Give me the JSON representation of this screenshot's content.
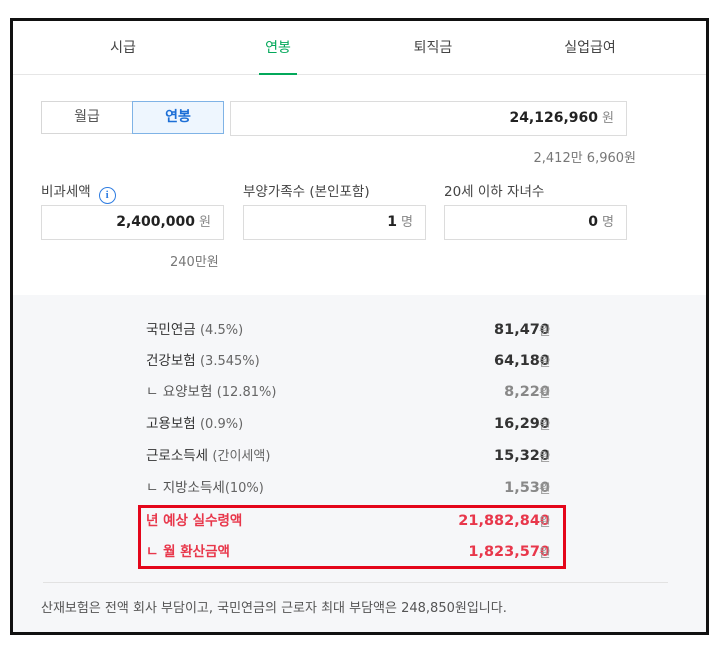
{
  "tabs": [
    "시급",
    "연봉",
    "퇴직금",
    "실업급여"
  ],
  "active_tab": "연봉",
  "pay_type": {
    "monthly": "월급",
    "annual": "연봉",
    "selected": "연봉"
  },
  "salary": {
    "value": "24,126,960",
    "unit": "원",
    "readable": "2,412만 6,960원"
  },
  "nontax": {
    "label": "비과세액",
    "info_icon": "info-icon",
    "value": "2,400,000",
    "unit": "원",
    "readable": "240만원"
  },
  "dependents": {
    "label": "부양가족수 (본인포함)",
    "value": "1",
    "unit": "명"
  },
  "children": {
    "label": "20세 이하 자녀수",
    "value": "0",
    "unit": "명"
  },
  "results": [
    {
      "name": "국민연금",
      "rate": "(4.5%)",
      "value": "81,470",
      "unit": "원",
      "sub": false
    },
    {
      "name": "건강보험",
      "rate": "(3.545%)",
      "value": "64,180",
      "unit": "원",
      "sub": false
    },
    {
      "name": "ㄴ 요양보험",
      "rate": "(12.81%)",
      "value": "8,220",
      "unit": "원",
      "sub": true
    },
    {
      "name": "고용보험",
      "rate": "(0.9%)",
      "value": "16,290",
      "unit": "원",
      "sub": false
    },
    {
      "name": "근로소득세",
      "rate": "(간이세액)",
      "value": "15,320",
      "unit": "원",
      "sub": false
    },
    {
      "name": "ㄴ 지방소득세",
      "rate": "(10%)",
      "value": "1,530",
      "unit": "원",
      "sub": true
    }
  ],
  "highlight": [
    {
      "name": "년 예상 실수령액",
      "value": "21,882,840",
      "unit": "원"
    },
    {
      "name": "ㄴ 월 환산금액",
      "value": "1,823,570",
      "unit": "원"
    }
  ],
  "note": "산재보험은 전액 회사 부담이고, 국민연금의 근로자 최대 부담액은 248,850원입니다.",
  "colors": {
    "accent_green": "#03a85a",
    "accent_blue": "#1d6fd6",
    "highlight_red": "#e8374b",
    "annotation_red": "#e4061b"
  }
}
